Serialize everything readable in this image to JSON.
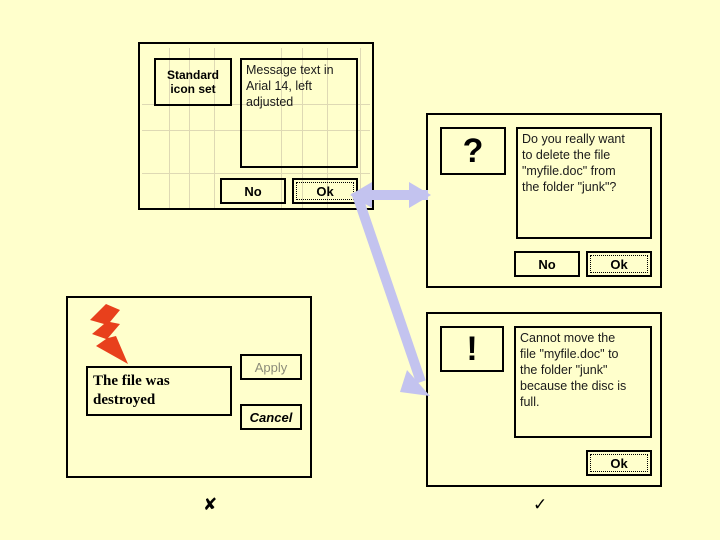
{
  "page": {
    "background_color": "#ffffcc",
    "accent_arrow_color": "#c3c3ef",
    "bolt_color": "#e8401c"
  },
  "dialog_template": {
    "icon_box_label": "Standard\nicon set",
    "message": "Message text in\nArial 14, left\nadjusted",
    "buttons": [
      {
        "label": "No",
        "focused": false
      },
      {
        "label": "Ok",
        "focused": true
      }
    ]
  },
  "dialog_question": {
    "icon": "question-mark",
    "icon_glyph": "?",
    "message": "Do you really want\nto delete the file\n\"myfile.doc\" from\nthe folder \"junk\"?",
    "buttons": [
      {
        "label": "No",
        "focused": false
      },
      {
        "label": "Ok",
        "focused": true
      }
    ]
  },
  "dialog_error": {
    "icon": "exclamation-mark",
    "icon_glyph": "!",
    "message": "Cannot move the\nfile \"myfile.doc\" to\nthe folder \"junk\"\nbecause the disc is\nfull.",
    "buttons": [
      {
        "label": "Ok",
        "focused": true
      }
    ]
  },
  "dialog_bad_example": {
    "icon": "lightning-bolt",
    "message": "The file was\ndestroyed",
    "buttons": [
      {
        "label": "Apply",
        "focused": false
      },
      {
        "label": "Cancel",
        "focused": false
      }
    ]
  },
  "verdicts": {
    "bad_mark": "✘",
    "good_mark": "✓"
  }
}
